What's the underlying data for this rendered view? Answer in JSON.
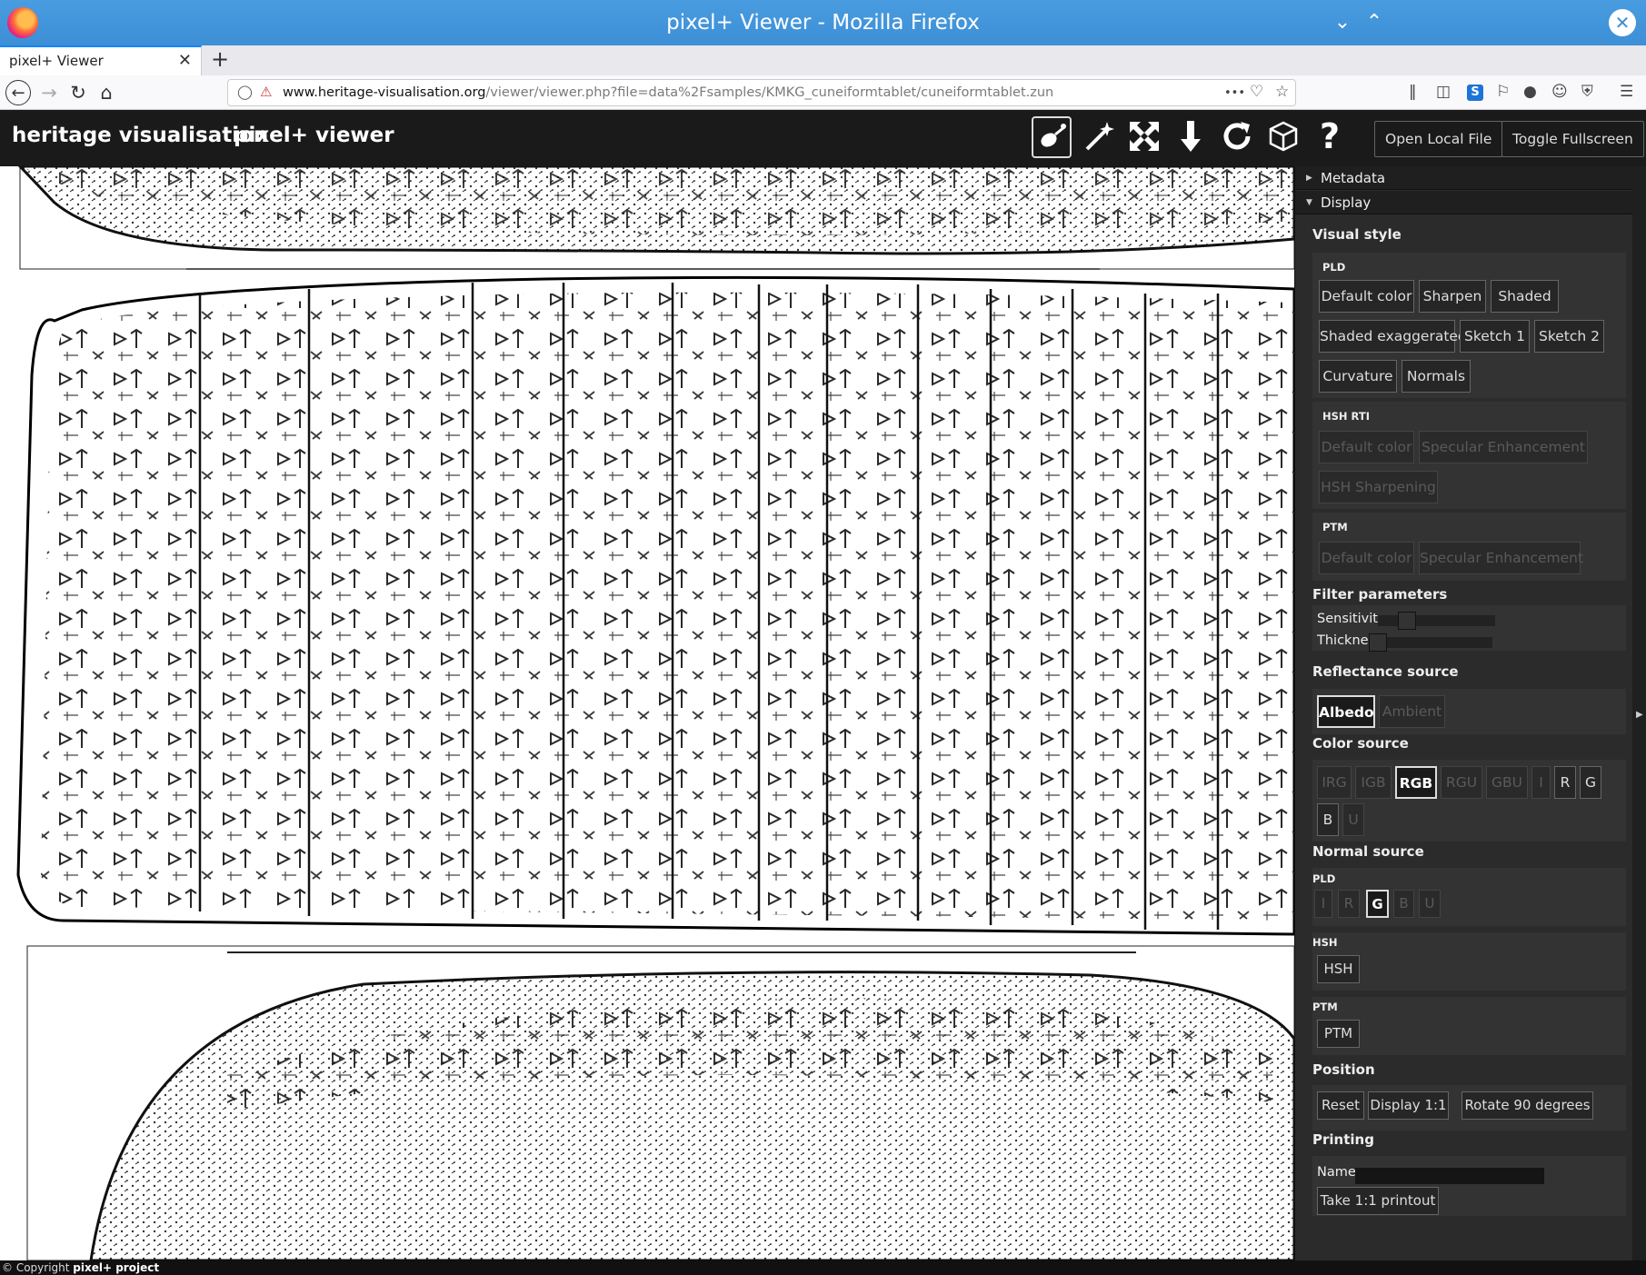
{
  "window": {
    "title": "pixel+ Viewer - Mozilla Firefox"
  },
  "tabs": [
    {
      "label": "pixel+ Viewer",
      "close": "✕"
    }
  ],
  "new_tab": "+",
  "url": {
    "domain": "www.heritage-visualisation.org",
    "path": "/viewer/viewer.php?file=data%2Fsamples/KMKG_cuneiformtablet/cuneiformtablet.zun",
    "more": "•••"
  },
  "header": {
    "brand": "heritage visualisation",
    "app": "pixel+ viewer",
    "tool_help": "?",
    "open_local": "Open Local File",
    "toggle_fullscreen": "Toggle Fullscreen"
  },
  "panel": {
    "metadata": "Metadata",
    "display": "Display",
    "visual_style": "Visual style",
    "pld_label": "PLD",
    "pld_buttons": [
      "Default color",
      "Sharpen",
      "Shaded",
      "Shaded exaggerated",
      "Sketch 1",
      "Sketch 2",
      "Curvature",
      "Normals"
    ],
    "hsh_rti_label": "HSH RTI",
    "hsh_rti_buttons": [
      "Default color",
      "Specular Enhancement",
      "HSH Sharpening"
    ],
    "ptm_label": "PTM",
    "ptm_buttons": [
      "Default color",
      "Specular Enhancement"
    ],
    "filter_params": "Filter parameters",
    "sensitivity": "Sensitivity",
    "thickness": "Thickness",
    "sensitivity_level": 0.2,
    "thickness_level": 0.0,
    "reflectance_source": "Reflectance source",
    "reflectance_buttons": [
      "Albedo",
      "Ambient"
    ],
    "color_source": "Color source",
    "color_buttons": [
      "IRG",
      "IGB",
      "RGB",
      "RGU",
      "GBU",
      "I",
      "R",
      "G",
      "B",
      "U"
    ],
    "normal_source": "Normal source",
    "normal_pld_label": "PLD",
    "normal_pld_buttons": [
      "I",
      "R",
      "G",
      "B",
      "U"
    ],
    "normal_hsh_label": "HSH",
    "normal_hsh_button": "HSH",
    "normal_ptm_label": "PTM",
    "normal_ptm_button": "PTM",
    "position": "Position",
    "position_buttons": [
      "Reset",
      "Display 1:1",
      "Rotate 90 degrees"
    ],
    "printing": "Printing",
    "name_label": "Name:",
    "print_button": "Take 1:1 printout"
  },
  "footer": {
    "copyright": "© Copyright",
    "project": "pixel+ project"
  },
  "colors": {
    "header_bg": "#1a1a1a",
    "panel_bg": "#2b2b2b",
    "titlebar": "#3d8fd6"
  }
}
